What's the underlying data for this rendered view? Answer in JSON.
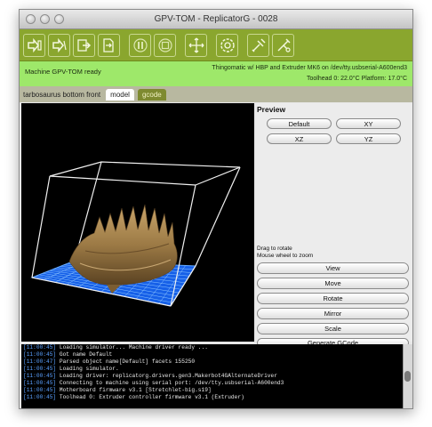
{
  "window": {
    "title": "GPV-TOM - ReplicatorG - 0028"
  },
  "toolbar": {
    "buttons": [
      {
        "icon": "machine-connect-icon"
      },
      {
        "icon": "machine-disconnect-icon"
      },
      {
        "icon": "build-icon"
      },
      {
        "icon": "build-to-file-icon"
      },
      {
        "icon": "pause-icon"
      },
      {
        "icon": "stop-icon"
      },
      {
        "icon": "move-axes-icon"
      },
      {
        "icon": "reset-icon"
      },
      {
        "icon": "control-panel-icon"
      },
      {
        "icon": "extruder-icon"
      }
    ]
  },
  "status": {
    "left": "Machine GPV-TOM ready",
    "right_line1": "Thingomatic w/ HBP and Extruder MK6 on /dev/tty.usbserial-A600end3",
    "right_line2": "Toolhead 0: 22.0°C  Platform: 17.0°C"
  },
  "tabs": {
    "file_title": "tarbosaurus bottom front",
    "model": "model",
    "gcode": "gcode"
  },
  "preview": {
    "heading": "Preview",
    "default": "Default",
    "xy": "XY",
    "xz": "XZ",
    "yz": "YZ",
    "hint1": "Drag to rotate",
    "hint2": "Mouse wheel to zoom",
    "view": "View",
    "move": "Move",
    "rotate": "Rotate",
    "mirror": "Mirror",
    "scale": "Scale",
    "generate": "Generate GCode"
  },
  "console": {
    "lines": [
      {
        "ts": "[11:00:45]",
        "text": " Loading simulator... Machine driver ready ..."
      },
      {
        "ts": "[11:00:45]",
        "text": " Got name Default"
      },
      {
        "ts": "[11:00:47]",
        "text": " Parsed object name[Default] facets 155250"
      },
      {
        "ts": "[11:00:45]",
        "text": " Loading simulator."
      },
      {
        "ts": "[11:00:45]",
        "text": " Loading driver: replicatorg.drivers.gen3.Makerbot4GAlternateDriver"
      },
      {
        "ts": "[11:00:45]",
        "text": " Connecting to machine using serial port: /dev/tty.usbserial-A600end3"
      },
      {
        "ts": "[11:00:45]",
        "text": " Motherboard firmware v3.1 [Stretchlet-big.s19]"
      },
      {
        "ts": "[11:00:45]",
        "text": " Toolhead 0: Extruder controller firmware v3.1 (Extruder)"
      }
    ]
  },
  "colors": {
    "toolbar": "#8aa62e",
    "status": "#9ee86a",
    "platform_grid": "#2d7cff",
    "model": "#9c7a45"
  }
}
